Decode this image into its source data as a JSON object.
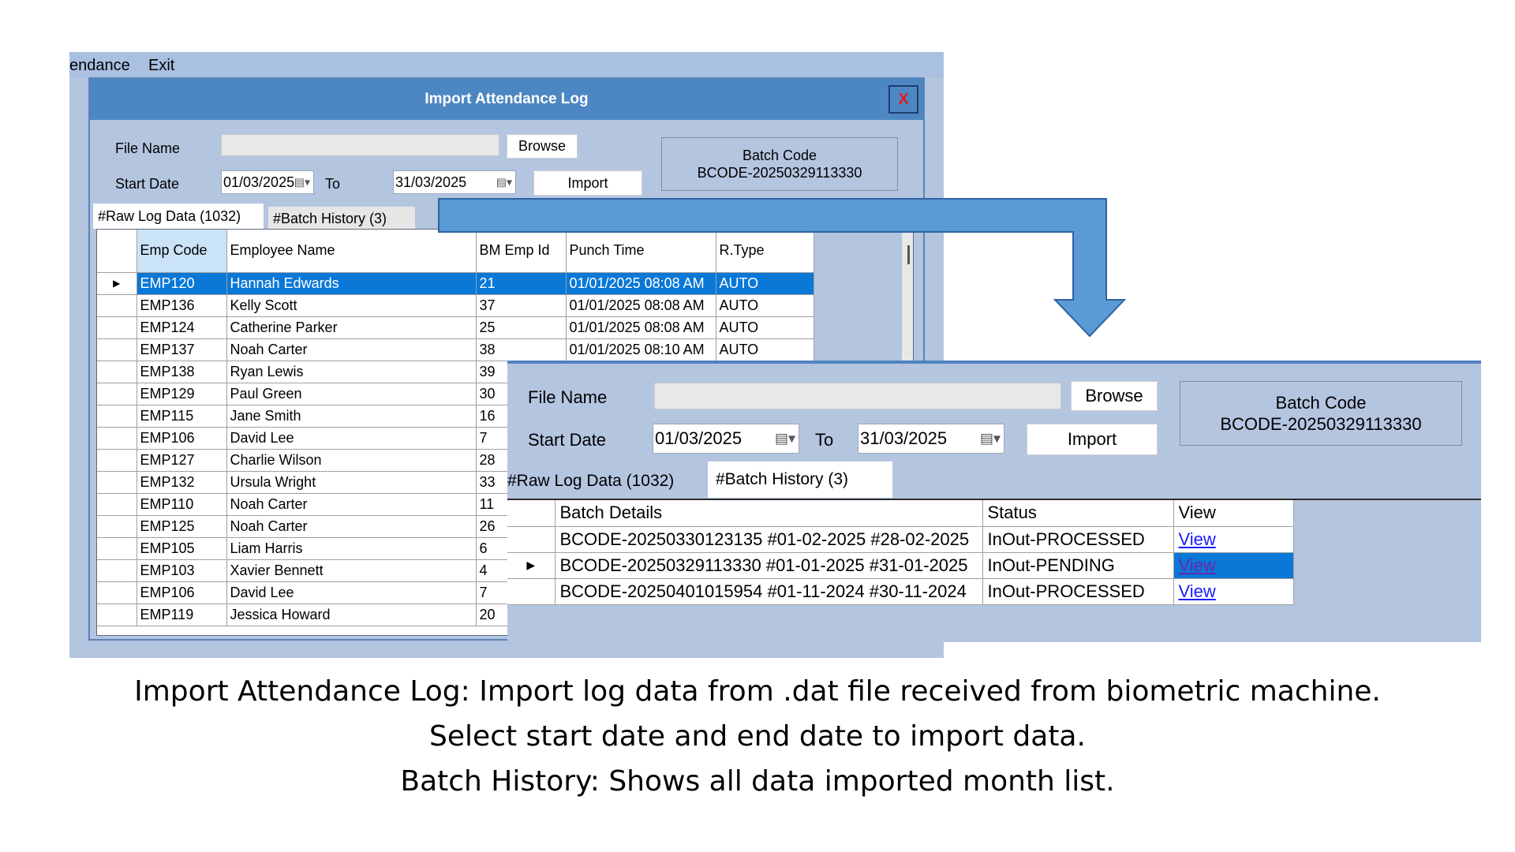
{
  "back_window": {
    "menu": [
      "endance",
      "Exit"
    ],
    "dialog_title": "Import Attendance Log",
    "close_label": "X",
    "file_name_label": "File Name",
    "file_name_value": "",
    "browse_label": "Browse",
    "start_date_label": "Start Date",
    "start_date": "01/03/2025",
    "to_label": "To",
    "end_date": "31/03/2025",
    "import_label": "Import",
    "batch_code_label": "Batch Code",
    "batch_code_value": "BCODE-20250329113330",
    "tabs": [
      "#Raw Log Data (1032)",
      "#Batch History (3)"
    ],
    "columns": [
      "Emp Code",
      "Employee Name",
      "BM Emp Id",
      "Punch Time",
      "R.Type"
    ],
    "rows": [
      [
        "EMP120",
        "Hannah Edwards",
        "21",
        "01/01/2025 08:08 AM",
        "AUTO"
      ],
      [
        "EMP136",
        "Kelly Scott",
        "37",
        "01/01/2025 08:08 AM",
        "AUTO"
      ],
      [
        "EMP124",
        "Catherine Parker",
        "25",
        "01/01/2025 08:08 AM",
        "AUTO"
      ],
      [
        "EMP137",
        "Noah Carter",
        "38",
        "01/01/2025 08:10 AM",
        "AUTO"
      ],
      [
        "EMP138",
        "Ryan Lewis",
        "39",
        "",
        ""
      ],
      [
        "EMP129",
        "Paul Green",
        "30",
        "",
        ""
      ],
      [
        "EMP115",
        "Jane Smith",
        "16",
        "",
        ""
      ],
      [
        "EMP106",
        "David Lee",
        "7",
        "",
        ""
      ],
      [
        "EMP127",
        "Charlie Wilson",
        "28",
        "",
        ""
      ],
      [
        "EMP132",
        "Ursula Wright",
        "33",
        "",
        ""
      ],
      [
        "EMP110",
        "Noah Carter",
        "11",
        "",
        ""
      ],
      [
        "EMP125",
        "Noah Carter",
        "26",
        "",
        ""
      ],
      [
        "EMP105",
        "Liam Harris",
        "6",
        "",
        ""
      ],
      [
        "EMP103",
        "Xavier Bennett",
        "4",
        "",
        ""
      ],
      [
        "EMP106",
        "David Lee",
        "7",
        "",
        ""
      ],
      [
        "EMP119",
        "Jessica Howard",
        "20",
        "",
        ""
      ]
    ]
  },
  "front_window": {
    "file_name_label": "File Name",
    "file_name_value": "",
    "browse_label": "Browse",
    "start_date_label": "Start Date",
    "start_date": "01/03/2025",
    "to_label": "To",
    "end_date": "31/03/2025",
    "import_label": "Import",
    "batch_code_label": "Batch Code",
    "batch_code_value": "BCODE-20250329113330",
    "tabs": [
      "#Raw Log Data (1032)",
      "#Batch History (3)"
    ],
    "columns": [
      "Batch Details",
      "Status",
      "View"
    ],
    "rows": [
      [
        "BCODE-20250330123135 #01-02-2025 #28-02-2025",
        "InOut-PROCESSED",
        "View"
      ],
      [
        "BCODE-20250329113330 #01-01-2025 #31-01-2025",
        "InOut-PENDING",
        "View"
      ],
      [
        "BCODE-20250401015954 #01-11-2024 #30-11-2024",
        "InOut-PROCESSED",
        "View"
      ]
    ]
  },
  "caption": [
    "Import Attendance Log: Import log data  from .dat file received from biometric machine.",
    "Select start date and end date to import data.",
    "Batch History: Shows all data imported month list."
  ],
  "colors": {
    "selection": "#0a78d7",
    "panel": "#b4c5e0",
    "titlebar": "#4d87c3",
    "arrow": "#5b9bd5"
  }
}
